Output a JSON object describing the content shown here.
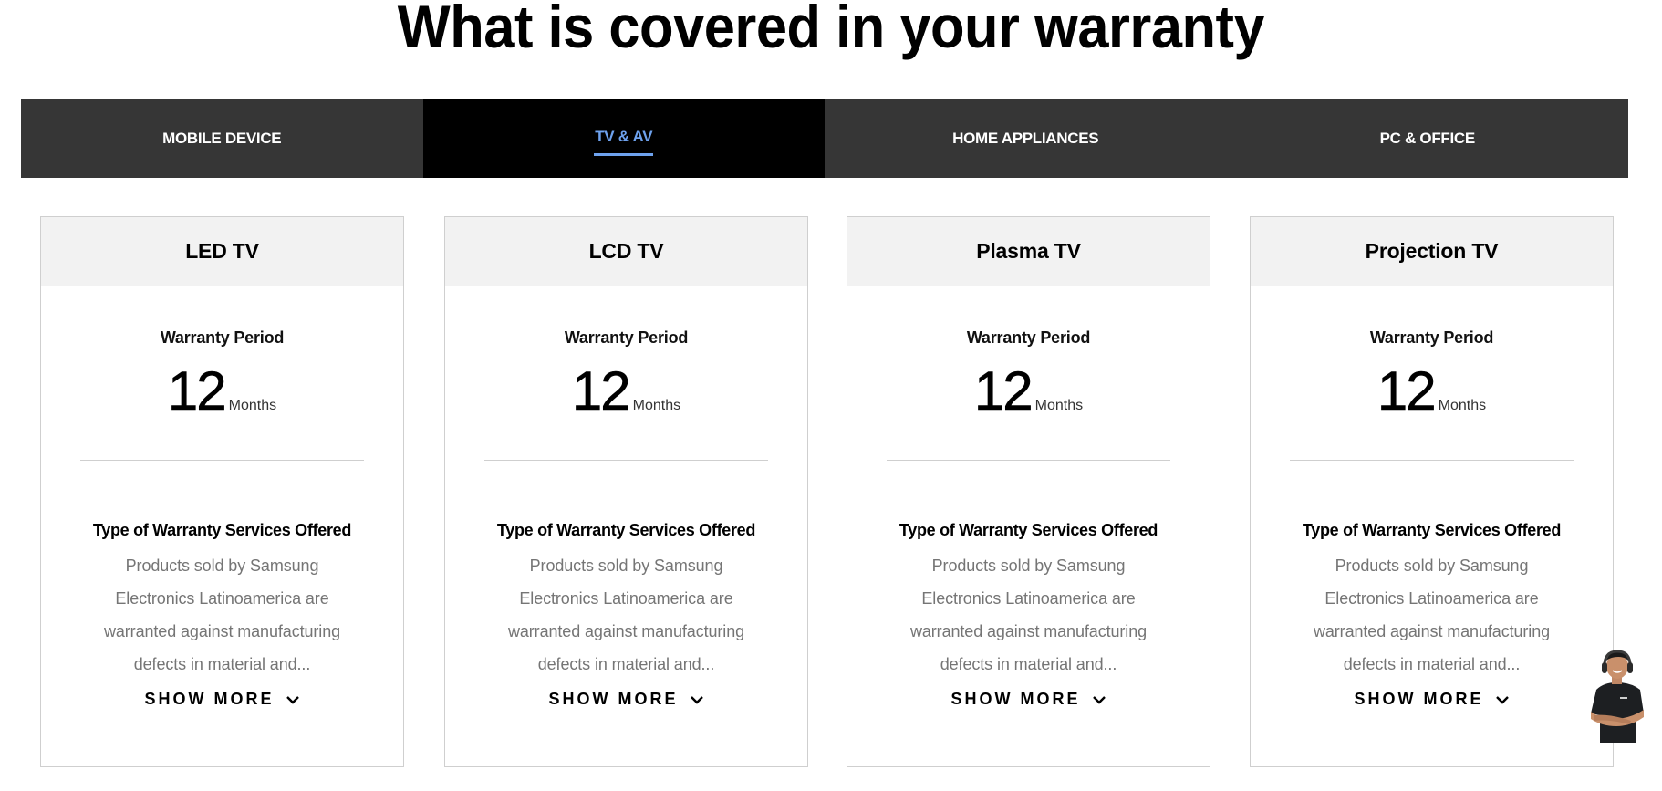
{
  "page": {
    "title": "What is covered in your warranty"
  },
  "tabs": [
    {
      "label": "MOBILE DEVICE",
      "active": false
    },
    {
      "label": "TV & AV",
      "active": true
    },
    {
      "label": "HOME APPLIANCES",
      "active": false
    },
    {
      "label": "PC & OFFICE",
      "active": false
    }
  ],
  "colors": {
    "tab_bar": "#363636",
    "tab_active_bg": "#000000",
    "tab_active_text": "#6ea2ee",
    "card_header_bg": "#f2f2f2",
    "description_text": "#757575"
  },
  "cards": [
    {
      "title": "LED TV",
      "period_label": "Warranty Period",
      "period_value": "12",
      "period_unit": "Months",
      "services_title": "Type of Warranty Services Offered",
      "services_desc": "Products sold by Samsung Electronics Latinoamerica are warranted against manufacturing defects in material and...",
      "show_more": "SHOW MORE"
    },
    {
      "title": "LCD TV",
      "period_label": "Warranty Period",
      "period_value": "12",
      "period_unit": "Months",
      "services_title": "Type of Warranty Services Offered",
      "services_desc": "Products sold by Samsung Electronics Latinoamerica are warranted against manufacturing defects in material and...",
      "show_more": "SHOW MORE"
    },
    {
      "title": "Plasma TV",
      "period_label": "Warranty Period",
      "period_value": "12",
      "period_unit": "Months",
      "services_title": "Type of Warranty Services Offered",
      "services_desc": "Products sold by Samsung Electronics Latinoamerica are warranted against manufacturing defects in material and...",
      "show_more": "SHOW MORE"
    },
    {
      "title": "Projection TV",
      "period_label": "Warranty Period",
      "period_value": "12",
      "period_unit": "Months",
      "services_title": "Type of Warranty Services Offered",
      "services_desc": "Products sold by Samsung Electronics Latinoamerica are warranted against manufacturing defects in material and...",
      "show_more": "SHOW MORE"
    }
  ],
  "chat": {
    "icon": "support-agent-avatar-icon"
  }
}
